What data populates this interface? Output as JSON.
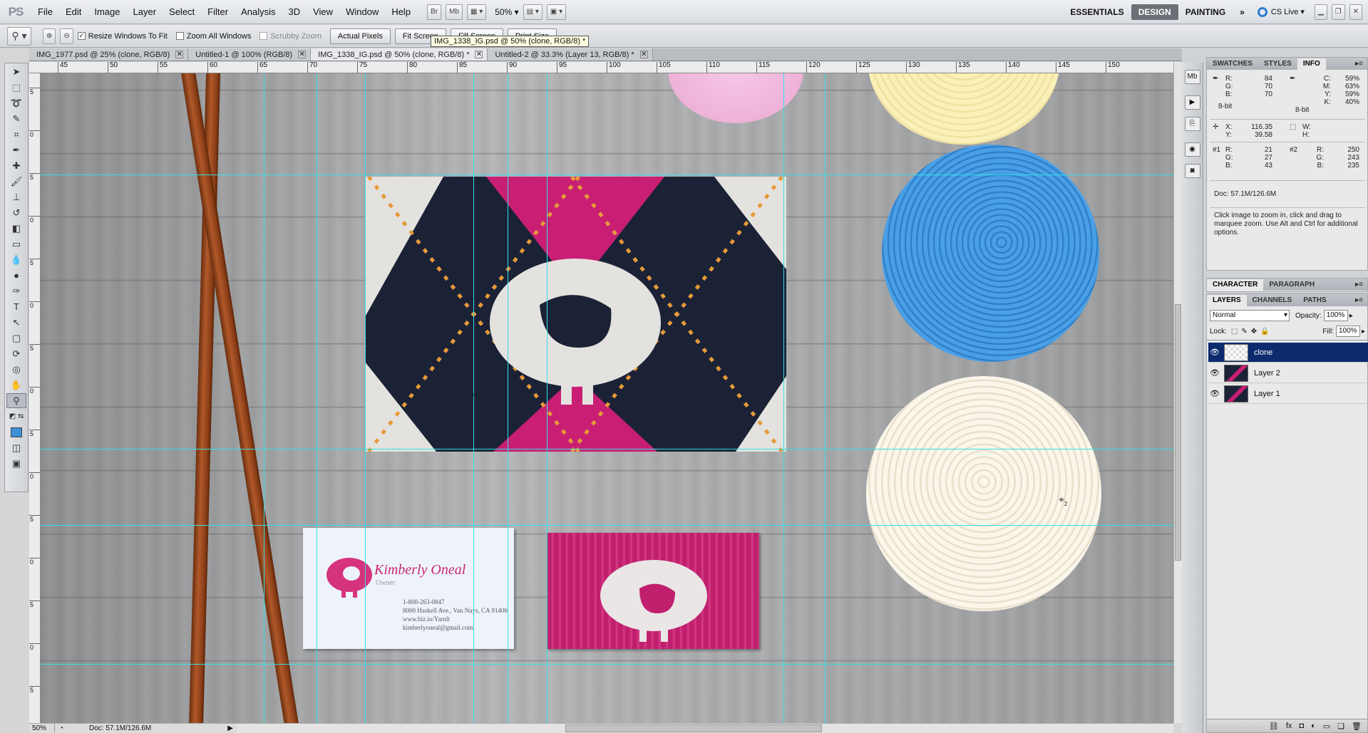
{
  "app": {
    "logo": "PS"
  },
  "menus": [
    "File",
    "Edit",
    "Image",
    "Layer",
    "Select",
    "Filter",
    "Analysis",
    "3D",
    "View",
    "Window",
    "Help"
  ],
  "appbar": {
    "br": "Br",
    "mb": "Mb",
    "zoom": "50%"
  },
  "workspaces": {
    "essentials": "ESSENTIALS",
    "design": "DESIGN",
    "painting": "PAINTING",
    "more": "»",
    "cslive": "CS Live ▾"
  },
  "options": {
    "resize_windows": "Resize Windows To Fit",
    "zoom_all": "Zoom All Windows",
    "scrubby": "Scrubby Zoom",
    "actual_pixels": "Actual Pixels",
    "fit_screen": "Fit Screen",
    "fill_screen": "Fill Screen",
    "print_size": "Print Size",
    "tooltip": "IMG_1338_IG.psd @ 50% (clone, RGB/8) *"
  },
  "tabs": [
    {
      "label": "IMG_1977.psd @ 25% (clone, RGB/8)"
    },
    {
      "label": "Untitled-1 @ 100% (RGB/8)"
    },
    {
      "label": "IMG_1338_IG.psd @ 50% (clone, RGB/8) *"
    },
    {
      "label": "Untitled-2 @ 33.3% (Layer 13, RGB/8) *"
    }
  ],
  "ruler_h": [
    "45",
    "50",
    "55",
    "60",
    "65",
    "70",
    "75",
    "80",
    "85",
    "90",
    "95",
    "100",
    "105",
    "110",
    "115",
    "120",
    "125",
    "130",
    "135",
    "140",
    "145",
    "150"
  ],
  "ruler_v": [
    "5",
    "0",
    "5",
    "0",
    "5",
    "0",
    "5",
    "0",
    "5",
    "0",
    "5",
    "0",
    "5",
    "0",
    "5"
  ],
  "card": {
    "name": "Kimberly Oneal",
    "title": "Owner",
    "phone": "1-800-263-0847",
    "address": "8000 Haskell Ave., Van Nuys, CA 91406",
    "web": "www.biz.io/Yarnlt",
    "email": "kimberlyoneal@gmail.com"
  },
  "status": {
    "zoom": "50%",
    "doc": "Doc: 57.1M/126.6M"
  },
  "panel_info": {
    "tabs": [
      "SWATCHES",
      "STYLES",
      "INFO"
    ],
    "rgb": {
      "r_label": "R:",
      "g_label": "G:",
      "b_label": "B:",
      "r": "84",
      "g": "70",
      "b": "70",
      "depth": "8-bit"
    },
    "cmyk": {
      "c_label": "C:",
      "m_label": "M:",
      "y_label": "Y:",
      "k_label": "K:",
      "c": "59%",
      "m": "63%",
      "y": "59%",
      "k": "40%",
      "depth": "8-bit"
    },
    "xy": {
      "x_label": "X:",
      "y_label": "Y:",
      "x": "116.35",
      "y": "39.58"
    },
    "wh": {
      "w_label": "W:",
      "h_label": "H:"
    },
    "s1": {
      "label": "#1",
      "r": "21",
      "g": "27",
      "b": "43"
    },
    "s2": {
      "label": "#2",
      "r": "250",
      "g": "243",
      "b": "235"
    },
    "doc": "Doc: 57.1M/126.6M",
    "hint": "Click image to zoom in, click and drag to marquee zoom.  Use Alt and Ctrl for additional options."
  },
  "panel_char": {
    "tabs": [
      "CHARACTER",
      "PARAGRAPH"
    ]
  },
  "panel_layers": {
    "tabs": [
      "LAYERS",
      "CHANNELS",
      "PATHS"
    ],
    "blend": "Normal",
    "opacity_label": "Opacity:",
    "opacity": "100%",
    "lock_label": "Lock:",
    "fill_label": "Fill:",
    "fill": "100%",
    "layers": [
      {
        "name": "clone"
      },
      {
        "name": "Layer 2"
      },
      {
        "name": "Layer 1"
      }
    ]
  },
  "colors": {
    "accent": "#0c2a6e",
    "guide": "#33e0e6",
    "knit_pink": "#c81f74",
    "knit_navy": "#1b2236",
    "yarn_blue": "#3d8fd8"
  }
}
